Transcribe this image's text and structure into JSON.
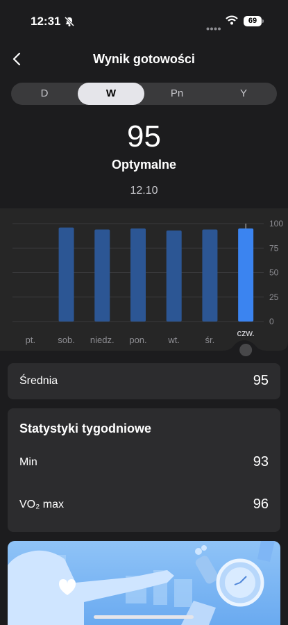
{
  "status": {
    "time": "12:31",
    "battery": "69"
  },
  "header": {
    "title": "Wynik gotowości"
  },
  "tabs": [
    {
      "label": "D",
      "active": false
    },
    {
      "label": "W",
      "active": true
    },
    {
      "label": "Pn",
      "active": false
    },
    {
      "label": "Y",
      "active": false
    }
  ],
  "summary": {
    "score": "95",
    "label": "Optymalne",
    "date": "12.10"
  },
  "chart_data": {
    "type": "bar",
    "categories": [
      "pt.",
      "sob.",
      "niedz.",
      "pon.",
      "wt.",
      "śr.",
      "czw."
    ],
    "values": [
      null,
      96,
      94,
      95,
      93,
      94,
      95
    ],
    "ylim": [
      0,
      100
    ],
    "yticks": [
      "0",
      "25",
      "50",
      "75",
      "100"
    ],
    "selected_index": 6,
    "colors": {
      "bar": "#2c5694",
      "selected": "#3b84f0"
    }
  },
  "average": {
    "label": "Średnia",
    "value": "95"
  },
  "weekly": {
    "title": "Statystyki tygodniowe",
    "rows": [
      {
        "label": "Min",
        "value": "93"
      },
      {
        "label": "VO₂ max",
        "value": "96"
      }
    ]
  }
}
